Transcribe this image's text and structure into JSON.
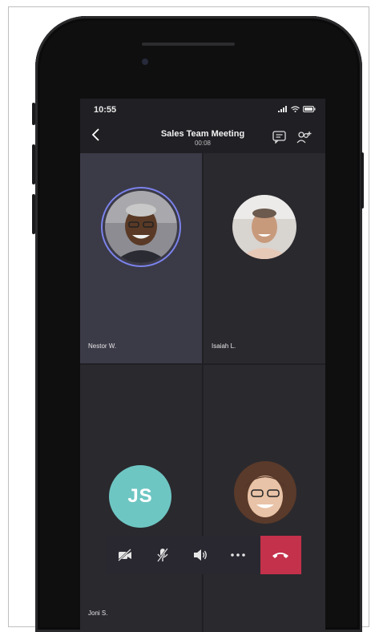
{
  "status_bar": {
    "time": "10:55"
  },
  "meeting": {
    "title": "Sales Team Meeting",
    "duration": "00:08"
  },
  "participants": [
    {
      "name": "Nestor W.",
      "speaking": true,
      "avatar": "photo"
    },
    {
      "name": "Isaiah L.",
      "speaking": false,
      "avatar": "photo"
    },
    {
      "name": "Joni S.",
      "speaking": false,
      "avatar": "initials",
      "initials": "JS",
      "avatar_color": "#6ec6c3"
    },
    {
      "name": "",
      "speaking": false,
      "avatar": "photo"
    }
  ],
  "controls": {
    "video": "camera-off-icon",
    "mic": "mic-off-icon",
    "speaker": "speaker-icon",
    "more": "more-icon",
    "hangup": "hang-up-icon"
  },
  "colors": {
    "active_tile": "#3b3a47",
    "tile": "#2a292e",
    "speaking_ring": "#7b83eb",
    "hangup": "#c4314b"
  }
}
